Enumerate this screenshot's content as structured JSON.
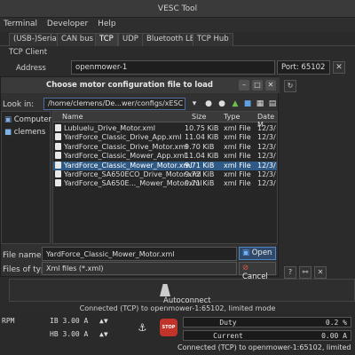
{
  "window": {
    "title": "VESC Tool"
  },
  "menu": [
    "Terminal",
    "Developer",
    "Help"
  ],
  "tabs": [
    "(USB-)Serial",
    "CAN bus",
    "TCP",
    "UDP",
    "Bluetooth LE",
    "TCP Hub"
  ],
  "tcp": {
    "section": "TCP Client",
    "address_label": "Address",
    "address_value": "openmower-1",
    "port_value": "Port: 65102"
  },
  "dialog": {
    "title": "Choose motor configuration file to load",
    "look_in_label": "Look in:",
    "path": "/home/clemens/De...wer/configs/xESC",
    "sidebar": [
      "Computer",
      "clemens"
    ],
    "headers": {
      "name": "Name",
      "size": "Size",
      "type": "Type",
      "date": "Date M"
    },
    "files": [
      {
        "name": "Lubluelu_Drive_Motor.xml",
        "size": "10.75 KiB",
        "type": "xml File",
        "date": "12/3/"
      },
      {
        "name": "YardForce_Classic_Drive_App.xml",
        "size": "11.04 KiB",
        "type": "xml File",
        "date": "12/3/"
      },
      {
        "name": "YardForce_Classic_Drive_Motor.xml",
        "size": "9.70 KiB",
        "type": "xml File",
        "date": "12/3/"
      },
      {
        "name": "YardForce_Classic_Mower_App.xml",
        "size": "11.04 KiB",
        "type": "xml File",
        "date": "12/3/"
      },
      {
        "name": "YardForce_Classic_Mower_Motor.xml",
        "size": "9.71 KiB",
        "type": "xml File",
        "date": "12/3/"
      },
      {
        "name": "YardForce_SA650ECO_Drive_Motor.xml",
        "size": "9.72 KiB",
        "type": "xml File",
        "date": "12/3/"
      },
      {
        "name": "YardForce_SA650E..._Mower_Motor.xml",
        "size": "9.71 KiB",
        "type": "xml File",
        "date": "12/3/"
      }
    ],
    "selected_index": 4,
    "file_name_label": "File name:",
    "file_name_value": "YardForce_Classic_Mower_Motor.xml",
    "file_type_label": "Files of type:",
    "file_type_value": "Xml files (*.xml)",
    "open_label": "Open",
    "cancel_label": "Cancel"
  },
  "autoconnect_label": "Autoconnect",
  "status": "Connected (TCP) to openmower-1:65102, limited mode",
  "bottom": {
    "rpm_label": "RPM",
    "ib": "IB 3.00 A",
    "hb": "HB 3.00 A",
    "stop_label": "STOP",
    "duty_label": "Duty",
    "duty_value": "0.2 %",
    "current_label": "Current",
    "current_value": "0.00 A",
    "status": "Connected (TCP) to openmower-1:65102, limited"
  }
}
